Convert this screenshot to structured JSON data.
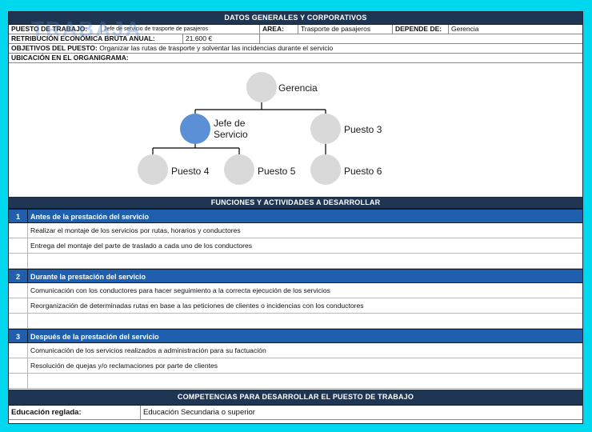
{
  "logo_text": "TRABAJA",
  "header": {
    "title": "DATOS GENERALES Y CORPORATIVOS",
    "puesto_label": "PUESTO DE TRABAJO:",
    "puesto_value": "Jefe de servicio de trasporte de pasajeros",
    "area_label": "AREA:",
    "area_value": "Trasporte de pasajeros",
    "depende_label": "DEPENDE DE:",
    "depende_value": "Gerencia",
    "retribucion_label": "RETRIBUCIÓN ECONÓMICA BRUTA ANUAL:",
    "retribucion_value": "21.600 €",
    "objetivos_label": "OBJETIVOS DEL PUESTO:",
    "objetivos_value": "Organizar las rutas de trasporte y solventar las incidencias durante el servicio",
    "ubicacion_label": "UBICACIÓN EN EL ORGANIGRAMA:"
  },
  "org_chart": {
    "gerencia": "Gerencia",
    "jefe": "Jefe de Servicio",
    "jefe_line1": "Jefe de",
    "jefe_line2": "Servicio",
    "puesto3": "Puesto 3",
    "puesto4": "Puesto 4",
    "puesto5": "Puesto 5",
    "puesto6": "Puesto 6",
    "node_color": "#d9d9d9",
    "highlight_color": "#5b8fd6"
  },
  "funciones": {
    "title": "FUNCIONES Y ACTIVIDADES A DESARROLLAR",
    "sections": [
      {
        "num": "1",
        "title": "Antes de la prestación del servicio",
        "tasks": [
          "Realizar el montaje de los servicios por rutas, horarios y conductores",
          "Entrega del montaje del parte de traslado a cada uno de los conductores",
          ""
        ]
      },
      {
        "num": "2",
        "title": "Durante la prestación del servicio",
        "tasks": [
          "Comunicación con los conductores para hacer seguimiento a la correcta ejecución de los servicios",
          "Reorganización de determinadas rutas en base a las peticiones de clientes o incidencias con los conductores",
          ""
        ]
      },
      {
        "num": "3",
        "title": "Después de la prestación del servicio",
        "tasks": [
          "Comunicación de los servicios realizados a administración para su factuación",
          "Resolución de quejas y/o reclamaciones por parte de clientes",
          ""
        ]
      }
    ]
  },
  "competencias": {
    "title": "COMPETENCIAS PARA DESARROLLAR EL PUESTO DE TRABAJO",
    "educacion_label": "Educación reglada:",
    "educacion_value": "Educación Secundaria o superior"
  },
  "colors": {
    "background": "#00d8f0",
    "dark_bar": "#1f3554",
    "section_bar": "#1f5fae"
  }
}
